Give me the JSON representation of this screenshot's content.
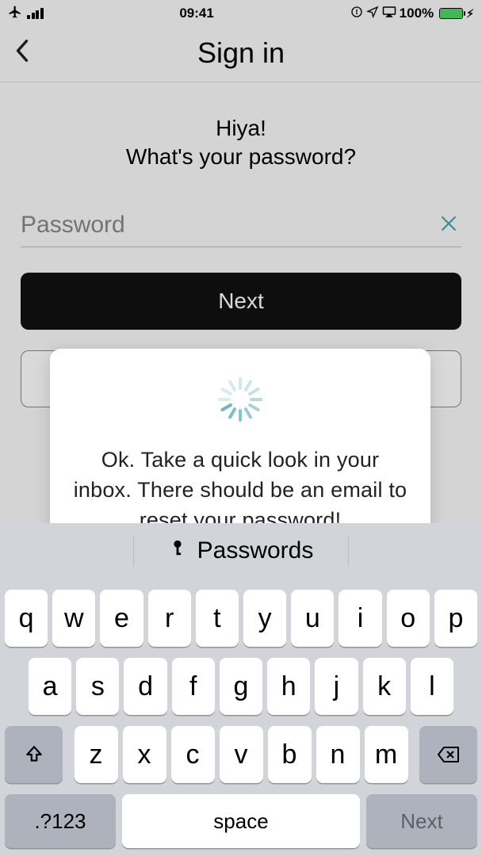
{
  "status_bar": {
    "time": "09:41",
    "battery_pct": "100%"
  },
  "header": {
    "title": "Sign in"
  },
  "content": {
    "greeting_line1": "Hiya!",
    "greeting_line2": "What's your password?",
    "password_placeholder": "Password",
    "next_label": "Next",
    "secondary_label": ""
  },
  "modal": {
    "text": "Ok. Take a quick look in your inbox. There should be an email to reset your password!"
  },
  "keyboard": {
    "suggestion": "Passwords",
    "row1": [
      "q",
      "w",
      "e",
      "r",
      "t",
      "y",
      "u",
      "i",
      "o",
      "p"
    ],
    "row2": [
      "a",
      "s",
      "d",
      "f",
      "g",
      "h",
      "j",
      "k",
      "l"
    ],
    "row3": [
      "z",
      "x",
      "c",
      "v",
      "b",
      "n",
      "m"
    ],
    "symbols_label": ".?123",
    "space_label": "space",
    "next_label": "Next"
  }
}
